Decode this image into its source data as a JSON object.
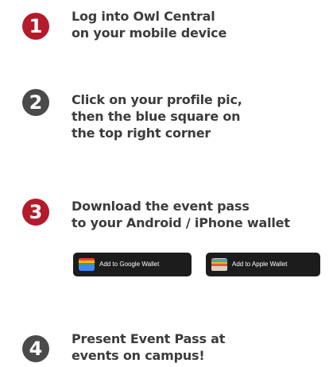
{
  "colors": {
    "badge_red": "#b31b2c",
    "badge_gray": "#4a4a4a",
    "text": "#3c3c3c",
    "button_bg": "#1c1c1c"
  },
  "steps": [
    {
      "number": "1",
      "badge_color": "#b31b2c",
      "lines": [
        "Log into Owl Central",
        "on your mobile device"
      ]
    },
    {
      "number": "2",
      "badge_color": "#4a4a4a",
      "lines": [
        "Click on your profile pic,",
        "then the blue square on",
        "the top right corner"
      ]
    },
    {
      "number": "3",
      "badge_color": "#b31b2c",
      "lines": [
        "Download the event pass",
        "to your Android / iPhone wallet"
      ]
    },
    {
      "number": "4",
      "badge_color": "#4a4a4a",
      "lines": [
        "Present Event Pass at",
        "events on campus!"
      ]
    }
  ],
  "buttons": {
    "google_wallet": {
      "label": "Add to Google Wallet",
      "icon": "google-wallet-icon"
    },
    "apple_wallet": {
      "label": "Add to Apple Wallet",
      "icon": "apple-wallet-icon"
    }
  }
}
